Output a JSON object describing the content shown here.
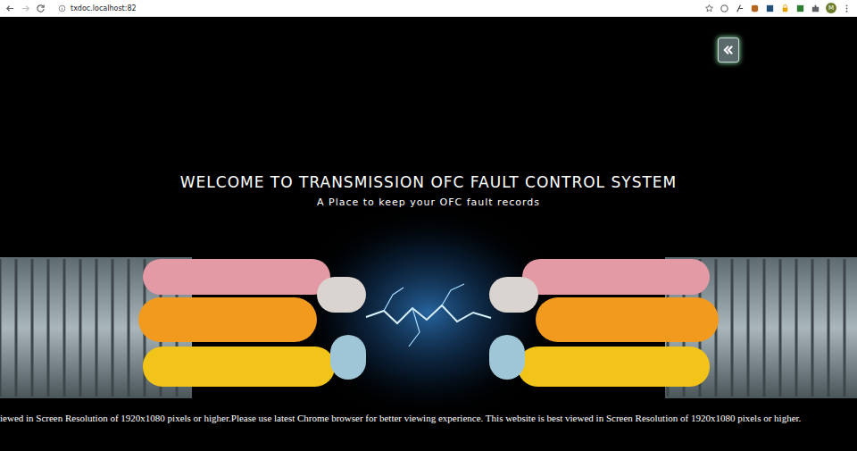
{
  "browser": {
    "url": "txdoc.localhost:82",
    "avatar": "M"
  },
  "hero": {
    "title": "WELCOME TO TRANSMISSION OFC FAULT CONTROL SYSTEM",
    "subtitle": "A Place to keep your OFC fault records"
  },
  "marquee": "iewed in Screen Resolution of 1920x1080 pixels or higher.Please use latest Chrome browser for better viewing experience. This website is best viewed in Screen Resolution of 1920x1080 pixels or higher."
}
